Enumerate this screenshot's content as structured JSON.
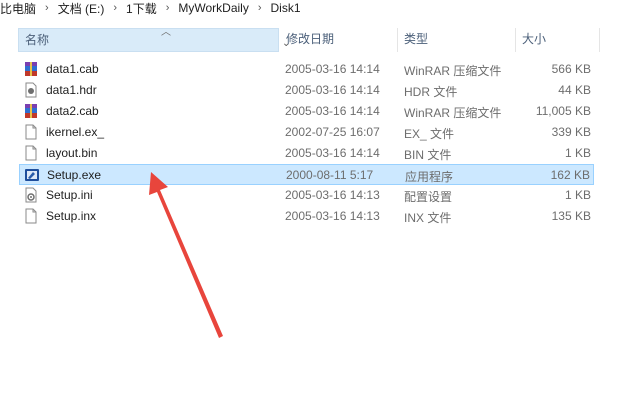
{
  "breadcrumb": {
    "items": [
      "比电脑",
      "文档 (E:)",
      "1下载",
      "MyWorkDaily",
      "Disk1"
    ],
    "separator": "›"
  },
  "columns": {
    "name": "名称",
    "date": "修改日期",
    "type": "类型",
    "size": "大小"
  },
  "files": [
    {
      "name": "data1.cab",
      "date": "2005-03-16 14:14",
      "type": "WinRAR 压缩文件",
      "size": "566 KB",
      "icon": "winrar-archive-icon"
    },
    {
      "name": "data1.hdr",
      "date": "2005-03-16 14:14",
      "type": "HDR 文件",
      "size": "44 KB",
      "icon": "hdr-file-icon"
    },
    {
      "name": "data2.cab",
      "date": "2005-03-16 14:14",
      "type": "WinRAR 压缩文件",
      "size": "11,005 KB",
      "icon": "winrar-archive-icon"
    },
    {
      "name": "ikernel.ex_",
      "date": "2002-07-25 16:07",
      "type": "EX_ 文件",
      "size": "339 KB",
      "icon": "generic-file-icon"
    },
    {
      "name": "layout.bin",
      "date": "2005-03-16 14:14",
      "type": "BIN 文件",
      "size": "1 KB",
      "icon": "generic-file-icon"
    },
    {
      "name": "Setup.exe",
      "date": "2000-08-11 5:17",
      "type": "应用程序",
      "size": "162 KB",
      "icon": "setup-exe-icon",
      "selected": true
    },
    {
      "name": "Setup.ini",
      "date": "2005-03-16 14:13",
      "type": "配置设置",
      "size": "1 KB",
      "icon": "config-file-icon"
    },
    {
      "name": "Setup.inx",
      "date": "2005-03-16 14:13",
      "type": "INX 文件",
      "size": "135 KB",
      "icon": "generic-file-icon"
    }
  ],
  "colors": {
    "selection_bg": "#cce8ff",
    "selection_border": "#99d1ff",
    "header_hover_bg": "#d9ebf9",
    "header_text": "#4c607a",
    "annotation_arrow": "#e8453c"
  }
}
